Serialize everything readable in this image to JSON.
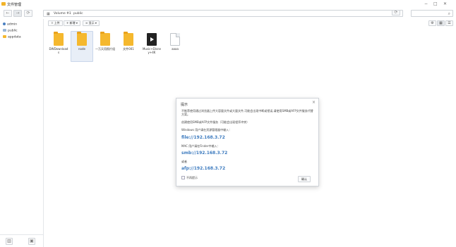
{
  "window": {
    "title": "文件管理",
    "minimize": "−",
    "maximize": "□",
    "close": "✕"
  },
  "nav": {
    "back": "←",
    "forward": "→",
    "refresh_left": "⟳",
    "breadcrumb": [
      "Volume #1",
      "public"
    ],
    "refresh": "⟳",
    "search_placeholder": ""
  },
  "sidebar": {
    "items": [
      {
        "label": "admin",
        "icon": "user-icon"
      },
      {
        "label": "public",
        "icon": "share-folder-icon"
      },
      {
        "label": "appdata",
        "icon": "folder-icon"
      }
    ]
  },
  "toolbar": {
    "upload": "上传",
    "new": "新增 ▾",
    "view": "显示 ▾"
  },
  "files": [
    {
      "name": "DWDownloads",
      "type": "folder",
      "selected": false
    },
    {
      "name": "node",
      "type": "folder",
      "selected": true
    },
    {
      "name": "一万天用照片组",
      "type": "folder",
      "selected": false
    },
    {
      "name": "文件001",
      "type": "folder",
      "selected": false
    },
    {
      "name": "Music+Disney+4K",
      "type": "video",
      "selected": false
    },
    {
      "name": "aaaa",
      "type": "document",
      "selected": false
    }
  ],
  "dialog": {
    "title": "提示",
    "close": "×",
    "line1": "不推荐使用通过浏览器上传大容量文件或大量文件,可能会出现中断或错误,请使用SMB或AFP文件服务代替方案。",
    "line2": "创建使用SMB或AFP文件服务（可能会出现程序冲突）",
    "windows_label": "Windows 用户请在资源管理器中输入：",
    "windows_path": "file://192.168.3.72",
    "mac_label": "MAC 用户请在Finder中输入：",
    "mac_smb": "smb://192.168.3.72",
    "or_label": "或者",
    "mac_afp": "afp://192.168.3.72",
    "dont_show": "不再提示",
    "ok": "确认"
  }
}
